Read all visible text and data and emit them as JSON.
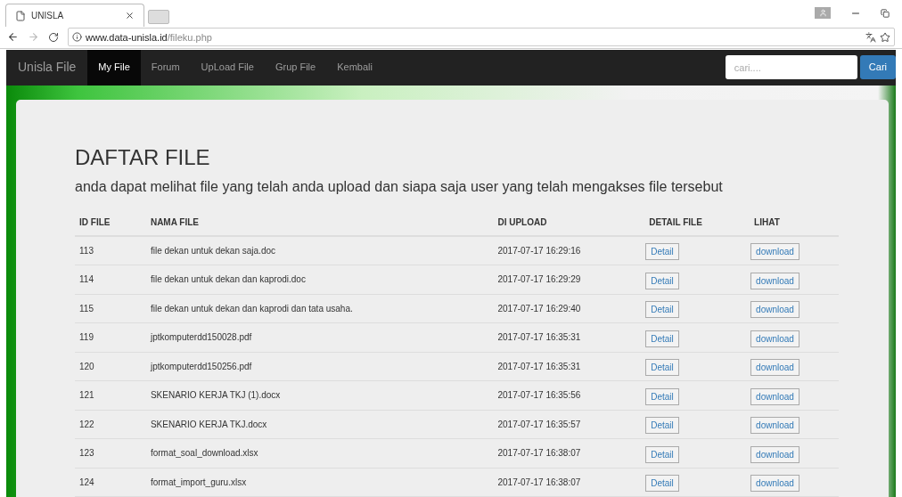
{
  "browser": {
    "tab_title": "UNISLA",
    "url_host": "www.data-unisla.id",
    "url_path": "/fileku.php"
  },
  "navbar": {
    "brand": "Unisla File",
    "items": [
      {
        "label": "My File",
        "selected": true
      },
      {
        "label": "Forum",
        "selected": false
      },
      {
        "label": "UpLoad File",
        "selected": false
      },
      {
        "label": "Grup File",
        "selected": false
      },
      {
        "label": "Kembali",
        "selected": false
      }
    ],
    "search": {
      "placeholder": "cari...."
    },
    "search_button": "Cari"
  },
  "page": {
    "title": "DAFTAR FILE",
    "subtitle": "anda dapat melihat file yang telah anda upload dan siapa saja user yang telah mengakses file tersebut"
  },
  "table": {
    "columns": [
      "ID FILE",
      "NAMA FILE",
      "DI UPLOAD",
      "DETAIL FILE",
      "LIHAT"
    ],
    "rows": [
      {
        "id": "113",
        "name": "file dekan untuk dekan saja.doc",
        "uploaded": "2017-07-17 16:29:16",
        "detail": "Detail",
        "view": "download"
      },
      {
        "id": "114",
        "name": "file dekan untuk dekan dan kaprodi.doc",
        "uploaded": "2017-07-17 16:29:29",
        "detail": "Detail",
        "view": "download"
      },
      {
        "id": "115",
        "name": "file dekan untuk dekan dan kaprodi dan tata usaha.",
        "uploaded": "2017-07-17 16:29:40",
        "detail": "Detail",
        "view": "download"
      },
      {
        "id": "119",
        "name": "jptkomputerdd150028.pdf",
        "uploaded": "2017-07-17 16:35:31",
        "detail": "Detail",
        "view": "download"
      },
      {
        "id": "120",
        "name": "jptkomputerdd150256.pdf",
        "uploaded": "2017-07-17 16:35:31",
        "detail": "Detail",
        "view": "download"
      },
      {
        "id": "121",
        "name": "SKENARIO KERJA TKJ (1).docx",
        "uploaded": "2017-07-17 16:35:56",
        "detail": "Detail",
        "view": "download"
      },
      {
        "id": "122",
        "name": "SKENARIO KERJA TKJ.docx",
        "uploaded": "2017-07-17 16:35:57",
        "detail": "Detail",
        "view": "download"
      },
      {
        "id": "123",
        "name": "format_soal_download.xlsx",
        "uploaded": "2017-07-17 16:38:07",
        "detail": "Detail",
        "view": "download"
      },
      {
        "id": "124",
        "name": "format_import_guru.xlsx",
        "uploaded": "2017-07-17 16:38:07",
        "detail": "Detail",
        "view": "download"
      }
    ]
  }
}
